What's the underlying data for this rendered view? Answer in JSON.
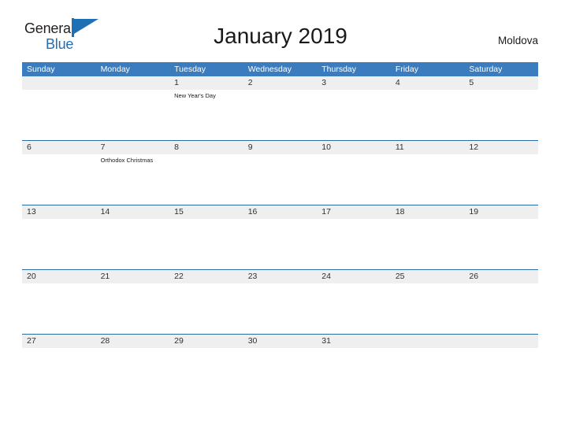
{
  "brand": {
    "name_part1": "General",
    "name_part2": "Blue",
    "flag_icon": "blue-flag-triangle",
    "color_dark": "#231f20",
    "color_blue": "#1f6fb5"
  },
  "header": {
    "title": "January 2019",
    "month": "January",
    "year": "2019",
    "country": "Moldova"
  },
  "theme": {
    "header_row_bg": "#3a7cbe",
    "header_row_text": "#ffffff",
    "week_divider": "#2b6ca8",
    "daynum_band_bg": "#efefef",
    "page_bg": "#ffffff",
    "text": "#1a1a1a"
  },
  "weekday_headers": [
    "Sunday",
    "Monday",
    "Tuesday",
    "Wednesday",
    "Thursday",
    "Friday",
    "Saturday"
  ],
  "weeks": [
    {
      "days": [
        {
          "num": "",
          "events": []
        },
        {
          "num": "",
          "events": []
        },
        {
          "num": "1",
          "events": [
            "New Year's Day"
          ]
        },
        {
          "num": "2",
          "events": []
        },
        {
          "num": "3",
          "events": []
        },
        {
          "num": "4",
          "events": []
        },
        {
          "num": "5",
          "events": []
        }
      ]
    },
    {
      "days": [
        {
          "num": "6",
          "events": []
        },
        {
          "num": "7",
          "events": [
            "Orthodox Christmas"
          ]
        },
        {
          "num": "8",
          "events": []
        },
        {
          "num": "9",
          "events": []
        },
        {
          "num": "10",
          "events": []
        },
        {
          "num": "11",
          "events": []
        },
        {
          "num": "12",
          "events": []
        }
      ]
    },
    {
      "days": [
        {
          "num": "13",
          "events": []
        },
        {
          "num": "14",
          "events": []
        },
        {
          "num": "15",
          "events": []
        },
        {
          "num": "16",
          "events": []
        },
        {
          "num": "17",
          "events": []
        },
        {
          "num": "18",
          "events": []
        },
        {
          "num": "19",
          "events": []
        }
      ]
    },
    {
      "days": [
        {
          "num": "20",
          "events": []
        },
        {
          "num": "21",
          "events": []
        },
        {
          "num": "22",
          "events": []
        },
        {
          "num": "23",
          "events": []
        },
        {
          "num": "24",
          "events": []
        },
        {
          "num": "25",
          "events": []
        },
        {
          "num": "26",
          "events": []
        }
      ]
    },
    {
      "days": [
        {
          "num": "27",
          "events": []
        },
        {
          "num": "28",
          "events": []
        },
        {
          "num": "29",
          "events": []
        },
        {
          "num": "30",
          "events": []
        },
        {
          "num": "31",
          "events": []
        },
        {
          "num": "",
          "events": []
        },
        {
          "num": "",
          "events": []
        }
      ]
    }
  ]
}
